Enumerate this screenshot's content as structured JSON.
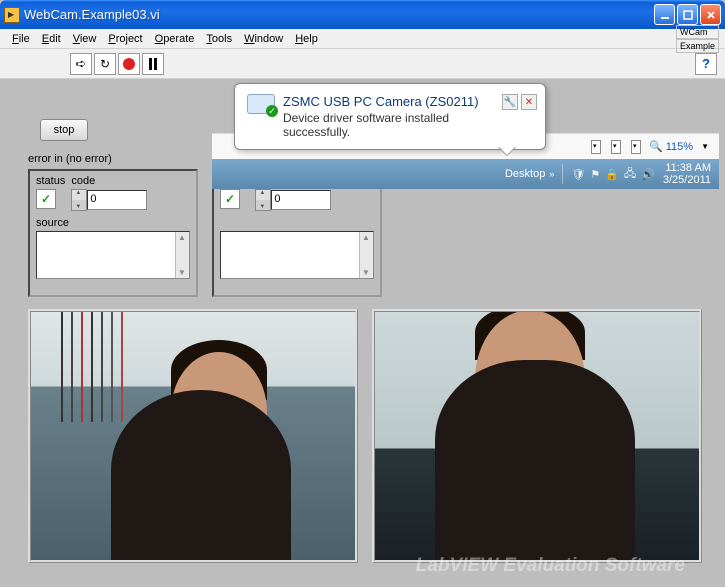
{
  "window": {
    "title": "WebCam.Example03.vi"
  },
  "menu": {
    "file": "File",
    "edit": "Edit",
    "view": "View",
    "project": "Project",
    "operate": "Operate",
    "tools": "Tools",
    "window": "Window",
    "help": "Help",
    "rightTag1": "WCam",
    "rightTag2": "Example"
  },
  "toolbar": {
    "run": "Run",
    "runCont": "Run Continuously",
    "abort": "Abort Execution",
    "pause": "Pause",
    "help": "?"
  },
  "panel": {
    "stop": "stop",
    "errorLabel": "error in (no error)",
    "cluster": {
      "status": "status",
      "code": "code",
      "codeVal": "0",
      "source": "source",
      "sourceVal": ""
    }
  },
  "balloon": {
    "title": "ZSMC USB PC Camera (ZS0211)",
    "body": "Device driver software installed successfully.",
    "toolIcon": "🔧",
    "closeIcon": "✕"
  },
  "strip": {
    "zoom": "115%"
  },
  "taskbar": {
    "desktop": "Desktop",
    "time": "11:38 AM",
    "date": "3/25/2011"
  },
  "watermark": "LabVIEW Evaluation Software"
}
